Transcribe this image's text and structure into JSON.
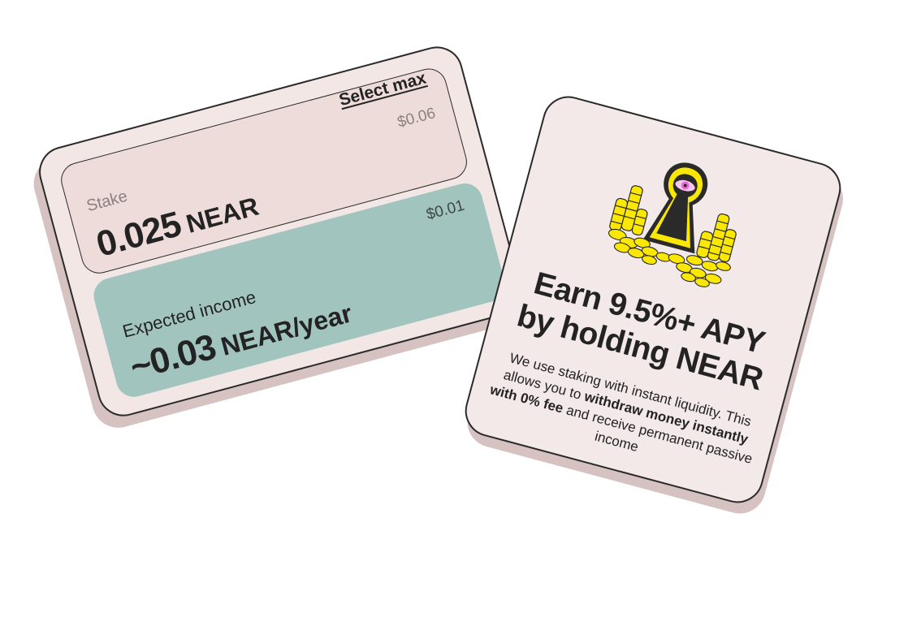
{
  "stake_card": {
    "select_max_label": "Select max",
    "stake_label": "Stake",
    "stake_usd": "$0.06",
    "stake_amount": "0.025",
    "stake_unit": "NEAR",
    "income_usd": "$0.01",
    "income_label": "Expected income",
    "income_amount": "~0.03",
    "income_unit": "NEAR/year"
  },
  "apy_card": {
    "title_line1": "Earn 9.5%+ APY",
    "title_line2": "by holding NEAR",
    "desc_part1": "We use staking with instant liquidity. This allows you to ",
    "desc_bold": "withdraw money instantly with 0% fee",
    "desc_part2": " and receive permanent passive income",
    "illustration_icon": "keyhole-eye-coins-icon"
  },
  "colors": {
    "card_bg": "#f3e7e6",
    "stake_box_bg": "#eedcdb",
    "income_box_bg": "#a2c4bf",
    "shadow": "#d6c3c1",
    "illustration_yellow": "#fbe704",
    "eye_pink": "#e86bd6"
  }
}
